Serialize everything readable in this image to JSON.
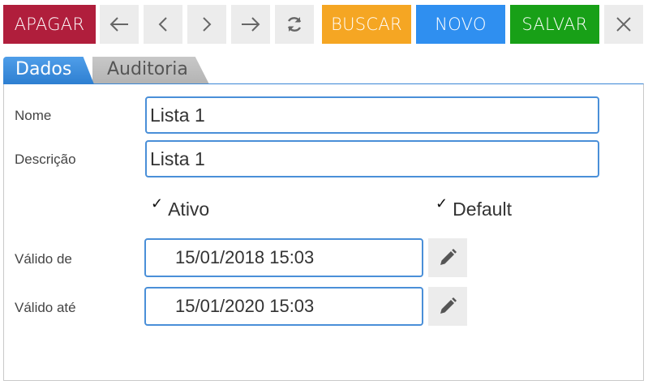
{
  "toolbar": {
    "apagar_label": "APAGAR",
    "buscar_label": "BUSCAR",
    "novo_label": "NOVO",
    "salvar_label": "SALVAR",
    "icons": [
      "arrow-left-icon",
      "chevron-left-icon",
      "chevron-right-icon",
      "arrow-right-icon",
      "refresh-icon",
      "close-icon"
    ],
    "colors": {
      "apagar": "#b01e3c",
      "buscar": "#f5a623",
      "novo": "#2f8ff0",
      "salvar": "#18a017"
    }
  },
  "tabs": [
    {
      "label": "Dados",
      "active": true
    },
    {
      "label": "Auditoria",
      "active": false
    }
  ],
  "form": {
    "nome_label": "Nome",
    "nome_value": "Lista 1",
    "descricao_label": "Descrição",
    "descricao_value": "Lista 1",
    "ativo_label": "Ativo",
    "ativo_checked": true,
    "default_label": "Default",
    "default_checked": true,
    "valido_de_label": "Válido de",
    "valido_de_value": "15/01/2018 15:03",
    "valido_ate_label": "Válido até",
    "valido_ate_value": "15/01/2020 15:03",
    "check_mark": "✓"
  }
}
